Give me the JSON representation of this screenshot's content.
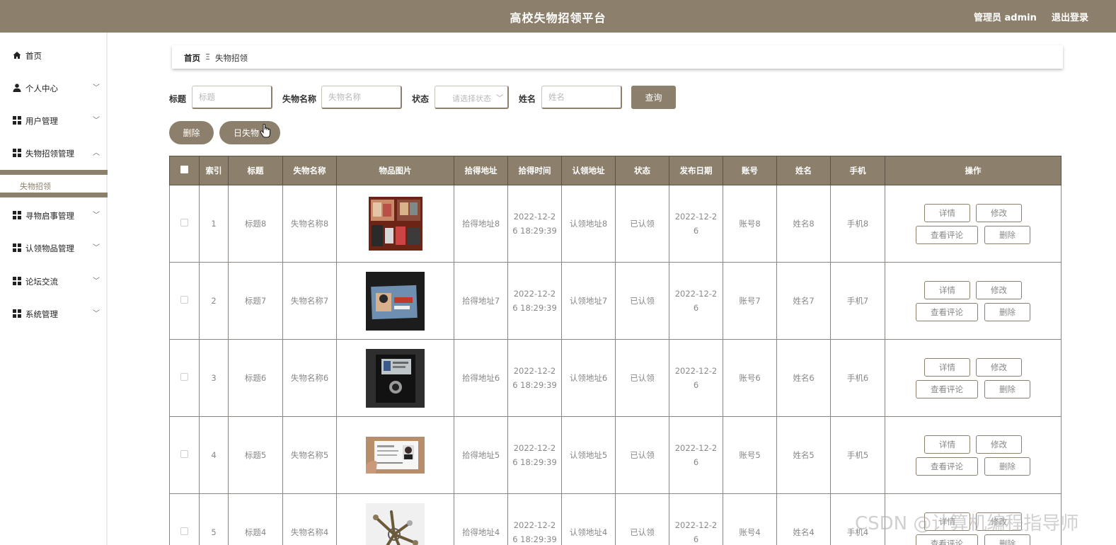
{
  "header": {
    "title": "高校失物招领平台",
    "admin": "管理员 admin",
    "logout": "退出登录"
  },
  "sidebar": {
    "items": [
      {
        "label": "首页",
        "icon": "home-icon"
      },
      {
        "label": "个人中心",
        "icon": "user-icon"
      },
      {
        "label": "用户管理",
        "icon": "grid-icon"
      },
      {
        "label": "失物招领管理",
        "icon": "grid-icon"
      },
      {
        "label": "寻物启事管理",
        "icon": "grid-icon"
      },
      {
        "label": "认领物品管理",
        "icon": "grid-icon"
      },
      {
        "label": "论坛交流",
        "icon": "grid-icon"
      },
      {
        "label": "系统管理",
        "icon": "grid-icon"
      }
    ],
    "active_sub": "失物招领"
  },
  "breadcrumb": {
    "home": "首页",
    "sep": "Ξ",
    "current": "失物招领"
  },
  "search": {
    "title_label": "标题",
    "title_placeholder": "标题",
    "name_label": "失物名称",
    "name_placeholder": "失物名称",
    "status_label": "状态",
    "status_placeholder": "请选择状态",
    "person_label": "姓名",
    "person_placeholder": "姓名",
    "query_button": "查询"
  },
  "actions": {
    "delete": "删除",
    "lost_items": "日失物"
  },
  "table": {
    "headers": [
      "",
      "索引",
      "标题",
      "失物名称",
      "物品图片",
      "拾得地址",
      "拾得时间",
      "认领地址",
      "状态",
      "发布日期",
      "账号",
      "姓名",
      "手机",
      "操作"
    ],
    "row_buttons": {
      "detail": "详情",
      "edit": "修改",
      "comments": "查看评论",
      "delete": "删除"
    },
    "rows": [
      {
        "index": "1",
        "title": "标题8",
        "name": "失物名称8",
        "image": "cash-and-cards-photo",
        "found_addr": "拾得地址8",
        "found_time_a": "2022-12-2",
        "found_time_b": "6 18:29:39",
        "claim_addr": "认领地址8",
        "status": "已认领",
        "pub_a": "2022-12-2",
        "pub_b": "6",
        "account": "账号8",
        "person": "姓名8",
        "phone": "手机8"
      },
      {
        "index": "2",
        "title": "标题7",
        "name": "失物名称7",
        "image": "card-photo",
        "found_addr": "拾得地址7",
        "found_time_a": "2022-12-2",
        "found_time_b": "6 18:29:39",
        "claim_addr": "认领地址7",
        "status": "已认领",
        "pub_a": "2022-12-2",
        "pub_b": "6",
        "account": "账号7",
        "person": "姓名7",
        "phone": "手机7"
      },
      {
        "index": "3",
        "title": "标题6",
        "name": "失物名称6",
        "image": "wallet-photo",
        "found_addr": "拾得地址6",
        "found_time_a": "2022-12-2",
        "found_time_b": "6 18:29:39",
        "claim_addr": "认领地址6",
        "status": "已认领",
        "pub_a": "2022-12-2",
        "pub_b": "6",
        "account": "账号6",
        "person": "姓名6",
        "phone": "手机6"
      },
      {
        "index": "4",
        "title": "标题5",
        "name": "失物名称5",
        "image": "id-card-photo",
        "found_addr": "拾得地址5",
        "found_time_a": "2022-12-2",
        "found_time_b": "6 18:29:39",
        "claim_addr": "认领地址5",
        "status": "已认领",
        "pub_a": "2022-12-2",
        "pub_b": "6",
        "account": "账号5",
        "person": "姓名5",
        "phone": "手机5"
      },
      {
        "index": "5",
        "title": "标题4",
        "name": "失物名称4",
        "image": "keys-photo",
        "found_addr": "拾得地址4",
        "found_time_a": "2022-12-2",
        "found_time_b": "6 18:29:39",
        "claim_addr": "认领地址4",
        "status": "已认领",
        "pub_a": "2022-12-2",
        "pub_b": "6",
        "account": "账号4",
        "person": "姓名4",
        "phone": "手机4"
      }
    ]
  },
  "watermark": "CSDN @计算机编程指导师",
  "colors": {
    "theme": "#8c806d",
    "border": "#5b5246"
  }
}
